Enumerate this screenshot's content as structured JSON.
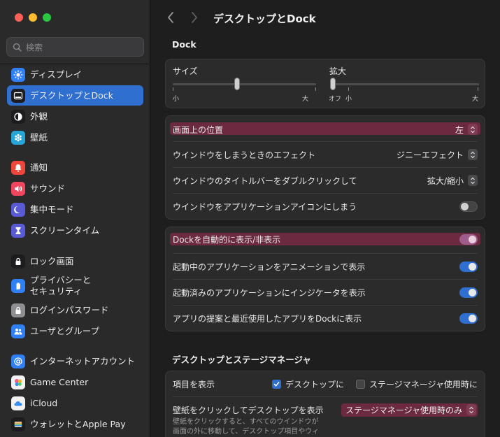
{
  "search": {
    "placeholder": "検索"
  },
  "sidebar": {
    "items": [
      {
        "label": "ディスプレイ",
        "icon": "display-icon"
      },
      {
        "label": "デスクトップとDock",
        "icon": "dock-icon"
      },
      {
        "label": "外観",
        "icon": "appearance-icon"
      },
      {
        "label": "壁紙",
        "icon": "wallpaper-icon"
      },
      {
        "label": "通知",
        "icon": "notification-icon"
      },
      {
        "label": "サウンド",
        "icon": "sound-icon"
      },
      {
        "label": "集中モード",
        "icon": "focus-icon"
      },
      {
        "label": "スクリーンタイム",
        "icon": "screentime-icon"
      },
      {
        "label": "ロック画面",
        "icon": "lock-screen-icon"
      },
      {
        "label": "プライバシーと",
        "label2": "セキュリティ",
        "icon": "privacy-icon"
      },
      {
        "label": "ログインパスワード",
        "icon": "login-password-icon"
      },
      {
        "label": "ユーザとグループ",
        "icon": "users-icon"
      },
      {
        "label": "インターネットアカウント",
        "icon": "internet-accounts-icon"
      },
      {
        "label": "Game Center",
        "icon": "game-center-icon"
      },
      {
        "label": "iCloud",
        "icon": "icloud-icon"
      },
      {
        "label": "ウォレットとApple Pay",
        "icon": "wallet-icon"
      }
    ]
  },
  "header": {
    "title": "デスクトップとDock"
  },
  "dock": {
    "section_title": "Dock",
    "size": {
      "label": "サイズ",
      "min": "小",
      "max": "大",
      "value": 0.45
    },
    "magnify": {
      "label": "拡大",
      "off": "オフ",
      "min": "小",
      "max": "大",
      "value": 0.0
    }
  },
  "position": {
    "rows": [
      {
        "label": "画面上の位置",
        "value": "左"
      },
      {
        "label": "ウインドウをしまうときのエフェクト",
        "value": "ジニーエフェクト"
      },
      {
        "label": "ウインドウのタイトルバーをダブルクリックして",
        "value": "拡大/縮小"
      },
      {
        "label": "ウインドウをアプリケーションアイコンにしまう"
      }
    ]
  },
  "autohide": {
    "rows": [
      {
        "label": "Dockを自動的に表示/非表示"
      },
      {
        "label": "起動中のアプリケーションをアニメーションで表示"
      },
      {
        "label": "起動済みのアプリケーションにインジケータを表示"
      },
      {
        "label": "アプリの提案と最近使用したアプリをDockに表示"
      }
    ]
  },
  "desktop": {
    "section_title": "デスクトップとステージマネージャ",
    "show_items": {
      "label": "項目を表示",
      "opt1": "デスクトップに",
      "opt2": "ステージマネージャ使用時に"
    },
    "click_wallpaper": {
      "label": "壁紙をクリックしてデスクトップを表示",
      "value": "ステージマネージャ使用時のみ",
      "note1": "壁紙をクリックすると、すべてのウインドウが",
      "note2": "画面の外に移動して、デスクトップ項目やウィ"
    }
  },
  "colors": {
    "accent": "#2f6fd0",
    "highlight": "#6b2a40"
  }
}
